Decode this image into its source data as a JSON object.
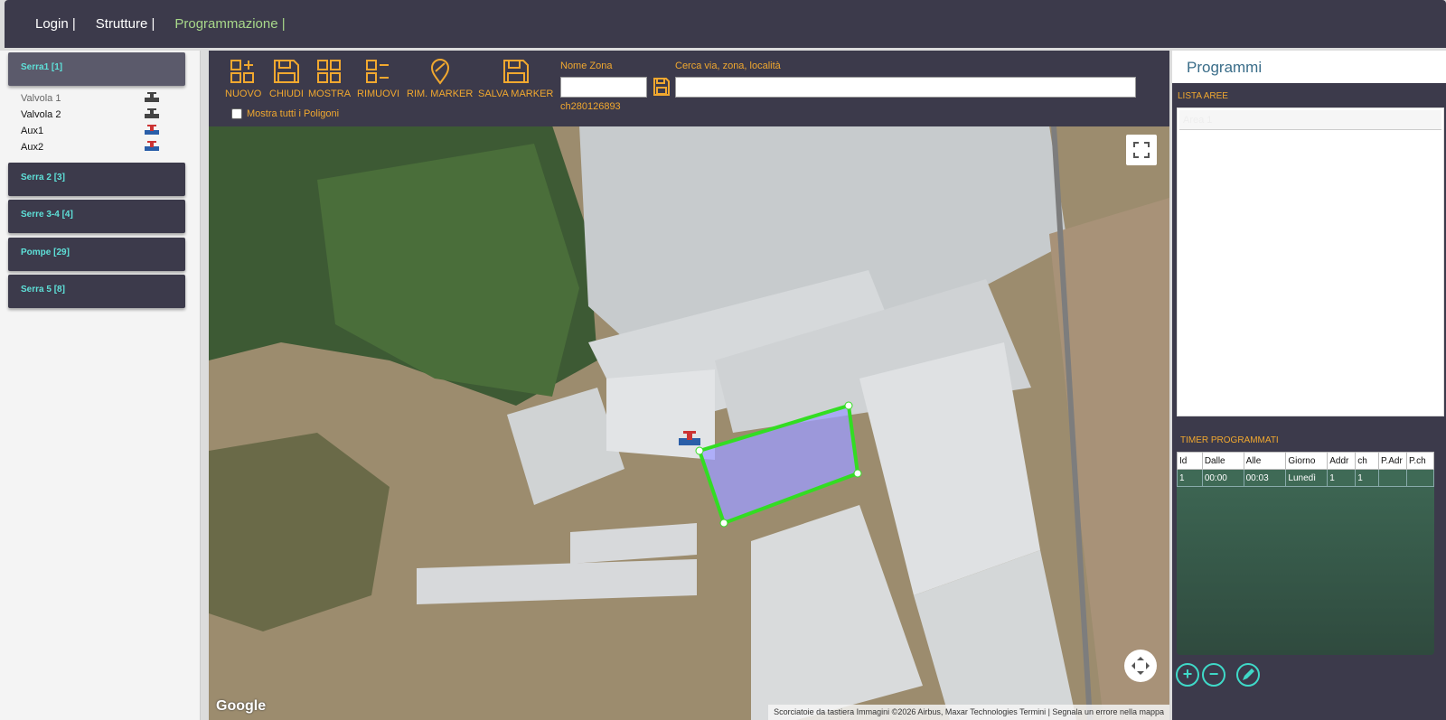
{
  "nav": {
    "login": "Login |",
    "strutture": "Strutture |",
    "programmazione": "Programmazione |"
  },
  "groups": [
    {
      "label": "Serra1 [1]",
      "open": true
    },
    {
      "label": "Serra 2 [3]"
    },
    {
      "label": "Serre 3-4 [4]"
    },
    {
      "label": "Pompe [29]"
    },
    {
      "label": "Serra 5 [8]"
    }
  ],
  "valves": [
    "Valvola 1",
    "Valvola 2",
    "Aux1",
    "Aux2"
  ],
  "toolbar": {
    "nuovo": "NUOVO",
    "chiudi": "CHIUDI",
    "mostra": "MOSTRA",
    "rimuovi": "RIMUOVI",
    "rim_marker": "RIM. MARKER",
    "salva_marker": "SALVA MARKER",
    "nome_zona_label": "Nome Zona",
    "nome_zona_value": "",
    "zona_id": "ch280126893",
    "cerca_label": "Cerca via, zona, località",
    "cerca_value": "",
    "mostra_poligoni": "Mostra tutti i Poligoni"
  },
  "right": {
    "title": "Programmi",
    "lista_aree": "LISTA AREE",
    "aree": [
      "Area 1"
    ],
    "timer_title": "TIMER PROGRAMMATI",
    "columns": [
      "Id",
      "Dalle",
      "Alle",
      "Giorno",
      "Addr",
      "ch",
      "P.Adr",
      "P.ch"
    ],
    "rows": [
      [
        "1",
        "00:00",
        "00:03",
        "Lunedì",
        "1",
        "1",
        "",
        ""
      ]
    ]
  },
  "map": {
    "google": "Google",
    "footer": "Scorciatoie da tastiera    Immagini ©2026 Airbus, Maxar Technologies    Termini  |  Segnala un errore nella mappa"
  },
  "colors": {
    "accent": "#f1a82f",
    "teal": "#3fd9c8",
    "polygon": "#33dd22"
  }
}
